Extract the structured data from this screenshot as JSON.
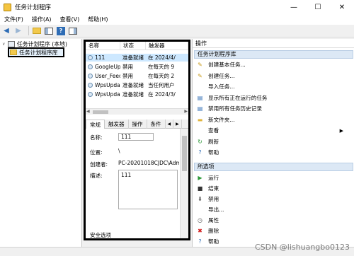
{
  "window": {
    "title": "任务计划程序",
    "minimize": "—",
    "maximize": "☐",
    "close": "✕"
  },
  "menu": [
    "文件(F)",
    "操作(A)",
    "查看(V)",
    "帮助(H)"
  ],
  "tree": {
    "root": "任务计划程序 (本地)",
    "library": "任务计划程序库"
  },
  "task_list": {
    "columns": [
      "名称",
      "状态",
      "触发器"
    ],
    "rows": [
      {
        "name": "111",
        "status": "准备就绪",
        "trigger": "在 2024/4/"
      },
      {
        "name": "GoogleUp...",
        "status": "禁用",
        "trigger": "在每天的 9"
      },
      {
        "name": "User_Feed_...",
        "status": "禁用",
        "trigger": "在每天的 2"
      },
      {
        "name": "WpsUpdat...",
        "status": "准备就绪",
        "trigger": "当任何用户"
      },
      {
        "name": "WpsUpdat...",
        "status": "准备就绪",
        "trigger": "在 2024/3/"
      }
    ]
  },
  "detail_tabs": [
    "常规",
    "触发器",
    "操作",
    "条件",
    "◀",
    "▶"
  ],
  "detail": {
    "name_label": "名称:",
    "name_value": "111",
    "location_label": "位置:",
    "location_value": "\\",
    "author_label": "创建者:",
    "author_value": "PC-20201018CJDC\\Adm",
    "desc_label": "描述:",
    "desc_value": "111",
    "security_label": "安全选项"
  },
  "actions": {
    "header": "操作",
    "section1": "任务计划程序库",
    "items1": [
      {
        "label": "创建基本任务...",
        "icon": "create-basic-task-icon",
        "glyph": "✎",
        "color": "#c89a1a"
      },
      {
        "label": "创建任务...",
        "icon": "create-task-icon",
        "glyph": "✎",
        "color": "#c89a1a"
      },
      {
        "label": "导入任务...",
        "icon": "import-icon",
        "glyph": "",
        "color": "#333"
      },
      {
        "label": "显示所有正在运行的任务",
        "icon": "running-tasks-icon",
        "glyph": "▤",
        "color": "#2f6db5"
      },
      {
        "label": "禁用所有任务历史记录",
        "icon": "disable-history-icon",
        "glyph": "▤",
        "color": "#2f6db5"
      },
      {
        "label": "新文件夹...",
        "icon": "new-folder-icon",
        "glyph": "▬",
        "color": "#e0b43c"
      },
      {
        "label": "查看",
        "icon": "view-icon",
        "glyph": "",
        "color": "#333",
        "submenu": true
      },
      {
        "label": "刷新",
        "icon": "refresh-icon",
        "glyph": "↻",
        "color": "#2e9a3a"
      },
      {
        "label": "帮助",
        "icon": "help-icon",
        "glyph": "?",
        "color": "#2f6db5"
      }
    ],
    "section2": "所选项",
    "items2": [
      {
        "label": "运行",
        "icon": "run-icon",
        "glyph": "▶",
        "color": "#2e9a3a"
      },
      {
        "label": "结束",
        "icon": "end-icon",
        "glyph": "■",
        "color": "#333"
      },
      {
        "label": "禁用",
        "icon": "disable-icon",
        "glyph": "⬇",
        "color": "#555"
      },
      {
        "label": "导出...",
        "icon": "export-icon",
        "glyph": "",
        "color": "#333"
      },
      {
        "label": "属性",
        "icon": "properties-icon",
        "glyph": "◷",
        "color": "#555"
      },
      {
        "label": "删除",
        "icon": "delete-icon",
        "glyph": "✖",
        "color": "#d21f1f"
      },
      {
        "label": "帮助",
        "icon": "help-icon",
        "glyph": "?",
        "color": "#2f6db5"
      }
    ]
  },
  "watermark": "CSDN @lishuangbo0123",
  "colors": {
    "selection": "#cde8ff",
    "section_header": "#dce8f5",
    "highlight_border": "#000000"
  }
}
